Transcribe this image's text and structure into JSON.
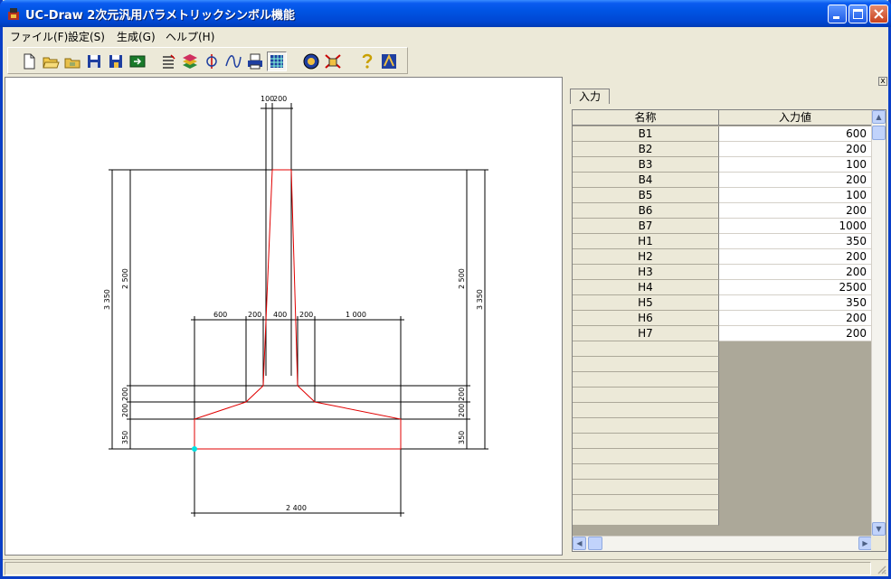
{
  "window": {
    "title": "UC-Draw 2次元汎用パラメトリックシンボル機能"
  },
  "menu": {
    "items": [
      {
        "label": "ファイル(F)"
      },
      {
        "label": "設定(S)"
      },
      {
        "label": "生成(G)"
      },
      {
        "label": "ヘルプ(H)"
      }
    ]
  },
  "toolbar": {
    "buttons": [
      {
        "icon": "new-file-icon"
      },
      {
        "icon": "open-folder-icon"
      },
      {
        "icon": "open-library-icon"
      },
      {
        "icon": "save-icon"
      },
      {
        "icon": "save-as-icon"
      },
      {
        "icon": "export-icon"
      },
      {
        "icon": "list-icon"
      },
      {
        "icon": "layers-icon"
      },
      {
        "icon": "transform-icon"
      },
      {
        "icon": "curve-icon"
      },
      {
        "icon": "print-icon"
      },
      {
        "icon": "grid-icon"
      },
      {
        "icon": "info-icon"
      },
      {
        "icon": "settings-icon"
      },
      {
        "icon": "help-icon"
      },
      {
        "icon": "about-icon"
      }
    ]
  },
  "drawing": {
    "dims": {
      "top_left": "100",
      "top_right": "200",
      "left_outer": "3 350",
      "left_inner": "2 500",
      "right_outer": "3 350",
      "right_inner": "2 500",
      "b1": "600",
      "b2": "200",
      "b4": "400",
      "b6": "200",
      "b7": "1 000",
      "left_h3": "200",
      "left_h2": "200",
      "left_h6": "200",
      "left_h1": "350",
      "right_h3": "200",
      "right_h2": "200",
      "right_h6": "200",
      "right_h1": "350",
      "bottom": "2 400"
    },
    "colors": {
      "outline": "#e00000",
      "dimension": "#000000",
      "origin_point": "#00e0e0"
    }
  },
  "panel": {
    "tab_label": "入力",
    "close_label": "x",
    "columns": [
      "名称",
      "入力値"
    ],
    "rows": [
      {
        "name": "B1",
        "value": "600"
      },
      {
        "name": "B2",
        "value": "200"
      },
      {
        "name": "B3",
        "value": "100"
      },
      {
        "name": "B4",
        "value": "200"
      },
      {
        "name": "B5",
        "value": "100"
      },
      {
        "name": "B6",
        "value": "200"
      },
      {
        "name": "B7",
        "value": "1000"
      },
      {
        "name": "H1",
        "value": "350"
      },
      {
        "name": "H2",
        "value": "200"
      },
      {
        "name": "H3",
        "value": "200"
      },
      {
        "name": "H4",
        "value": "2500"
      },
      {
        "name": "H5",
        "value": "350"
      },
      {
        "name": "H6",
        "value": "200"
      },
      {
        "name": "H7",
        "value": "200"
      }
    ],
    "empty_rows": 12
  }
}
